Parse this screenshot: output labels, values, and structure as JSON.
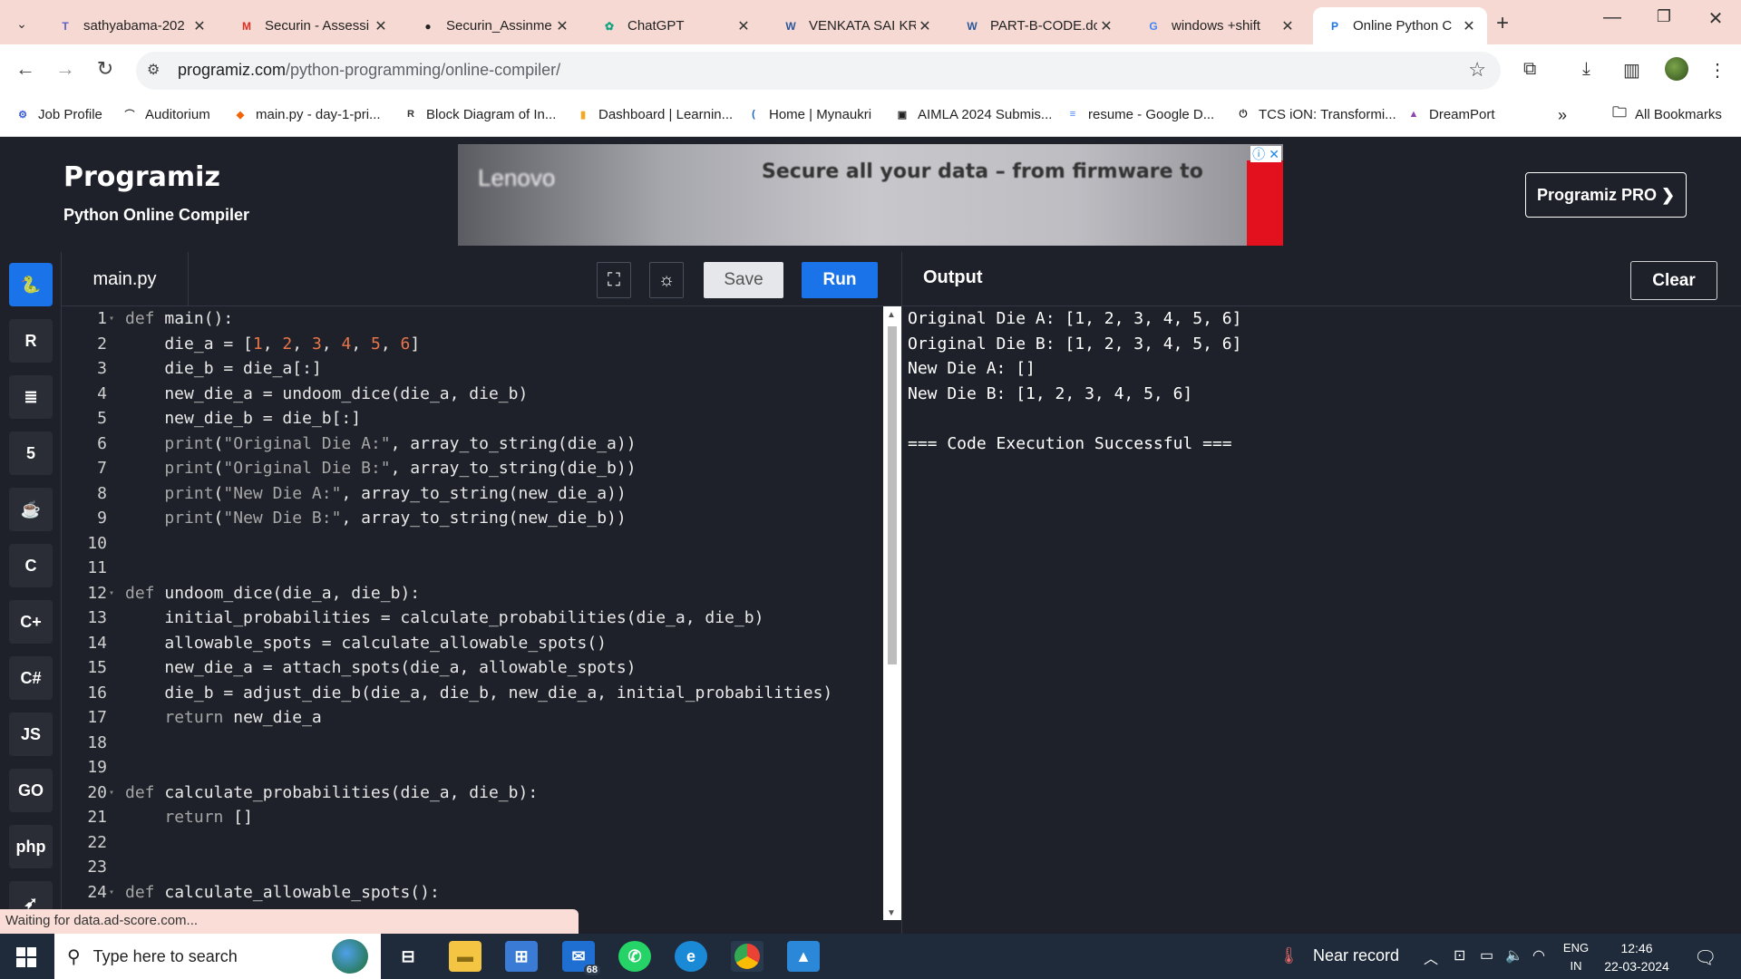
{
  "browser": {
    "tabs": [
      {
        "label": "sathyabama-202",
        "favicon": "teams-icon",
        "color": "#5b5fc7"
      },
      {
        "label": "Securin - Assessi",
        "favicon": "gmail-icon",
        "color": "#d93025"
      },
      {
        "label": "Securin_Assinme",
        "favicon": "github-icon",
        "color": "#222222"
      },
      {
        "label": "ChatGPT",
        "favicon": "chatgpt-icon",
        "color": "#10a37f"
      },
      {
        "label": "VENKATA SAI KR",
        "favicon": "word-icon",
        "color": "#2b579a"
      },
      {
        "label": "PART-B-CODE.dc",
        "favicon": "word-icon",
        "color": "#2b579a"
      },
      {
        "label": "windows +shift",
        "favicon": "google-icon",
        "color": "#4285f4"
      },
      {
        "label": "Online Python C",
        "favicon": "programiz-icon",
        "color": "#1a73e8"
      }
    ],
    "url_host": "programiz.com",
    "url_path": "/python-programming/online-compiler/",
    "bookmarks": [
      {
        "label": "Job Profile",
        "favicon": "job-icon",
        "color": "#3b5bdb"
      },
      {
        "label": "Auditorium",
        "favicon": "auditorium-icon",
        "color": "#444444"
      },
      {
        "label": "main.py - day-1-pri...",
        "favicon": "replit-icon",
        "color": "#f26207"
      },
      {
        "label": "Block Diagram of In...",
        "favicon": "r-icon",
        "color": "#333333"
      },
      {
        "label": "Dashboard | Learnin...",
        "favicon": "dashboard-icon",
        "color": "#f5a623"
      },
      {
        "label": "Home | Mynaukri",
        "favicon": "mynaukri-icon",
        "color": "#1565c0"
      },
      {
        "label": "AIMLA 2024 Submis...",
        "favicon": "aimla-icon",
        "color": "#222222"
      },
      {
        "label": "resume - Google D...",
        "favicon": "docs-icon",
        "color": "#4285f4"
      },
      {
        "label": "TCS iON: Transformi...",
        "favicon": "tcs-icon",
        "color": "#222222"
      },
      {
        "label": "DreamPort",
        "favicon": "dreamport-icon",
        "color": "#8e44ad"
      }
    ],
    "all_bookmarks": "All Bookmarks"
  },
  "header": {
    "logo": "Programiz",
    "subtitle": "Python Online Compiler",
    "pro_button": "Programiz PRO ❯",
    "ad_text": "Secure all your data – from firmware to",
    "ad_brand": "Lenovo"
  },
  "editor": {
    "file_tab": "main.py",
    "save_label": "Save",
    "run_label": "Run",
    "lines": [
      {
        "n": "1",
        "fold": true,
        "html": "<span class='kw'>def</span> main():"
      },
      {
        "n": "2",
        "fold": false,
        "html": "    die_a = [<span class='num'>1</span>, <span class='num'>2</span>, <span class='num'>3</span>, <span class='num'>4</span>, <span class='num'>5</span>, <span class='num'>6</span>]"
      },
      {
        "n": "3",
        "fold": false,
        "html": "    die_b = die_a[:]"
      },
      {
        "n": "4",
        "fold": false,
        "html": "    new_die_a = undoom_dice(die_a, die_b)"
      },
      {
        "n": "5",
        "fold": false,
        "html": "    new_die_b = die_b[:]"
      },
      {
        "n": "6",
        "fold": false,
        "html": "    <span class='kw'>print</span>(<span class='str'>\"Original Die A:\"</span>, array_to_string(die_a))"
      },
      {
        "n": "7",
        "fold": false,
        "html": "    <span class='kw'>print</span>(<span class='str'>\"Original Die B:\"</span>, array_to_string(die_b))"
      },
      {
        "n": "8",
        "fold": false,
        "html": "    <span class='kw'>print</span>(<span class='str'>\"New Die A:\"</span>, array_to_string(new_die_a))"
      },
      {
        "n": "9",
        "fold": false,
        "html": "    <span class='kw'>print</span>(<span class='str'>\"New Die B:\"</span>, array_to_string(new_die_b))"
      },
      {
        "n": "10",
        "fold": false,
        "html": ""
      },
      {
        "n": "11",
        "fold": false,
        "html": ""
      },
      {
        "n": "12",
        "fold": true,
        "html": "<span class='kw'>def</span> undoom_dice(die_a, die_b):"
      },
      {
        "n": "13",
        "fold": false,
        "html": "    initial_probabilities = calculate_probabilities(die_a, die_b)"
      },
      {
        "n": "14",
        "fold": false,
        "html": "    allowable_spots = calculate_allowable_spots()"
      },
      {
        "n": "15",
        "fold": false,
        "html": "    new_die_a = attach_spots(die_a, allowable_spots)"
      },
      {
        "n": "16",
        "fold": false,
        "html": "    die_b = adjust_die_b(die_a, die_b, new_die_a, initial_probabilities)"
      },
      {
        "n": "17",
        "fold": false,
        "html": "    <span class='kw'>return</span> new_die_a"
      },
      {
        "n": "18",
        "fold": false,
        "html": ""
      },
      {
        "n": "19",
        "fold": false,
        "html": ""
      },
      {
        "n": "20",
        "fold": true,
        "html": "<span class='kw'>def</span> calculate_probabilities(die_a, die_b):"
      },
      {
        "n": "21",
        "fold": false,
        "html": "    <span class='kw'>return</span> []"
      },
      {
        "n": "22",
        "fold": false,
        "html": ""
      },
      {
        "n": "23",
        "fold": false,
        "html": ""
      },
      {
        "n": "24",
        "fold": true,
        "html": "<span class='kw'>def</span> calculate_allowable_spots():"
      }
    ]
  },
  "output": {
    "title": "Output",
    "clear_label": "Clear",
    "lines": [
      "Original Die A: [1, 2, 3, 4, 5, 6]",
      "Original Die B: [1, 2, 3, 4, 5, 6]",
      "New Die A: []",
      "New Die B: [1, 2, 3, 4, 5, 6]",
      "",
      "=== Code Execution Successful ==="
    ]
  },
  "sidebar": {
    "languages": [
      {
        "name": "python",
        "glyph": "🐍",
        "active": true
      },
      {
        "name": "r",
        "glyph": "R",
        "active": false
      },
      {
        "name": "sql",
        "glyph": "≣",
        "active": false
      },
      {
        "name": "html",
        "glyph": "5",
        "active": false
      },
      {
        "name": "java",
        "glyph": "☕",
        "active": false
      },
      {
        "name": "c",
        "glyph": "C",
        "active": false
      },
      {
        "name": "cpp",
        "glyph": "C+",
        "active": false
      },
      {
        "name": "csharp",
        "glyph": "C#",
        "active": false
      },
      {
        "name": "javascript",
        "glyph": "JS",
        "active": false
      },
      {
        "name": "go",
        "glyph": "GO",
        "active": false
      },
      {
        "name": "php",
        "glyph": "php",
        "active": false
      },
      {
        "name": "swift",
        "glyph": "➶",
        "active": false
      }
    ]
  },
  "status": "Waiting for data.ad-score.com...",
  "taskbar": {
    "search_placeholder": "Type here to search",
    "mail_badge": "68",
    "weather": "Near record",
    "lang_line1": "ENG",
    "lang_line2": "IN",
    "time": "12:46",
    "date": "22-03-2024"
  }
}
